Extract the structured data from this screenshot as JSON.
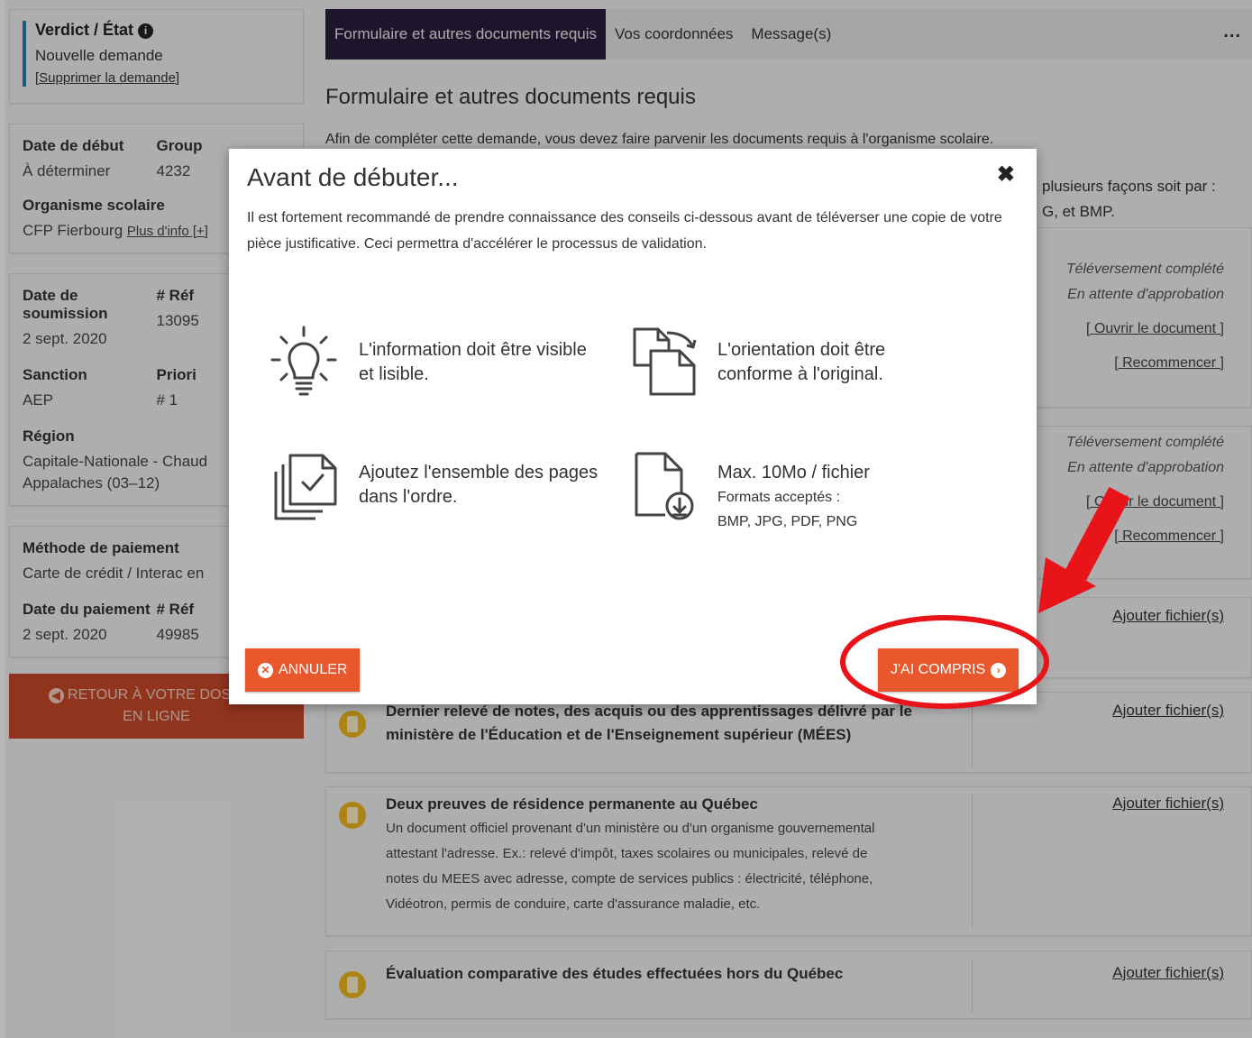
{
  "sidebar": {
    "verdict_title": "Verdict / État",
    "verdict_status": "Nouvelle demande",
    "delete_link": "[Supprimer la demande]",
    "start_date_label": "Date de début",
    "start_date_value": "À déterminer",
    "group_label": "Group",
    "group_value": "4232",
    "school_label": "Organisme scolaire",
    "school_value": "CFP Fierbourg",
    "school_more_link": "Plus d'info [+]",
    "submission_label": "Date de soumission",
    "submission_value": "2 sept. 2020",
    "ref_label": "# Réf",
    "ref_value": "13095",
    "sanction_label": "Sanction",
    "sanction_value": "AEP",
    "priority_label": "Priori",
    "priority_value": "# 1",
    "region_label": "Région",
    "region_value_1": "Capitale-Nationale - Chaud",
    "region_value_2": "Appalaches (03–12)",
    "payment_method_label": "Méthode de paiement",
    "payment_method_value": "Carte de crédit / Interac en",
    "payment_date_label": "Date du paiement",
    "payment_date_value": "2 sept. 2020",
    "payment_ref_label": "# Réf",
    "payment_ref_value": "49985",
    "back_button_line1": "RETOUR À VOTRE DOSSIER",
    "back_button_line2": "EN LIGNE"
  },
  "tabs": [
    {
      "label": "Formulaire et autres documents requis",
      "active": true
    },
    {
      "label": "Vos coordonnées",
      "active": false
    },
    {
      "label": "Message(s)",
      "active": false
    }
  ],
  "tab_more": "...",
  "main": {
    "title": "Formulaire et autres documents requis",
    "intro": "Afin de compléter cette demande, vous devez faire parvenir les documents requis à l'organisme scolaire.",
    "intro_right_1": "plusieurs façons soit par :",
    "intro_right_2": "G, et BMP.",
    "doc1_status_1": "Téléversement complété",
    "doc1_status_2": "En attente d'approbation",
    "doc1_open": "[ Ouvrir le document ]",
    "doc1_restart": "[ Recommencer ]",
    "doc2_status_1": "Téléversement complété",
    "doc2_status_2": "En attente d'approbation",
    "doc2_open": "[ Ouvrir le document ]",
    "doc2_restart": "[ Recommencer ]",
    "doc3_add": "Ajouter fichier(s)",
    "doc4_title_1": "Dernier relevé de notes, des acquis ou des apprentissages délivré par le",
    "doc4_title_2": "ministère de l'Éducation et de l'Enseignement supérieur (MÉES)",
    "doc4_add": "Ajouter fichier(s)",
    "doc5_title": "Deux preuves de résidence permanente au Québec",
    "doc5_desc_1": "Un document officiel provenant d'un ministère ou d'un organisme gouvernemental",
    "doc5_desc_2": "attestant l'adresse. Ex.: relevé d'impôt, taxes scolaires ou municipales, relevé de",
    "doc5_desc_3": "notes du MEES avec adresse, compte de services publics : électricité, téléphone,",
    "doc5_desc_4": "Vidéotron, permis de conduire, carte d'assurance maladie, etc.",
    "doc5_add": "Ajouter fichier(s)",
    "doc6_title": "Évaluation comparative des études effectuées hors du Québec",
    "doc6_add": "Ajouter fichier(s)"
  },
  "modal": {
    "title": "Avant de débuter...",
    "close": "✖",
    "text": "Il est fortement recommandé de prendre connaissance des conseils ci-dessous avant de téléverser une copie de votre pièce justificative. Ceci permettra d'accélérer le processus de validation.",
    "tip1_1": "L'information doit être visible",
    "tip1_2": "et lisible.",
    "tip2_1": "L'orientation doit être",
    "tip2_2": "conforme à l'original.",
    "tip3_1": "Ajoutez l'ensemble des pages",
    "tip3_2": "dans l'ordre.",
    "tip4_1": "Max. 10Mo / fichier",
    "tip4_2": "Formats acceptés :",
    "tip4_3": "BMP, JPG, PDF, PNG",
    "cancel_label": "ANNULER",
    "ok_label": "J'AI COMPRIS"
  },
  "colors": {
    "accent": "#e8582c",
    "tab_active": "#2a1d3d",
    "annotation": "#e8141a"
  }
}
